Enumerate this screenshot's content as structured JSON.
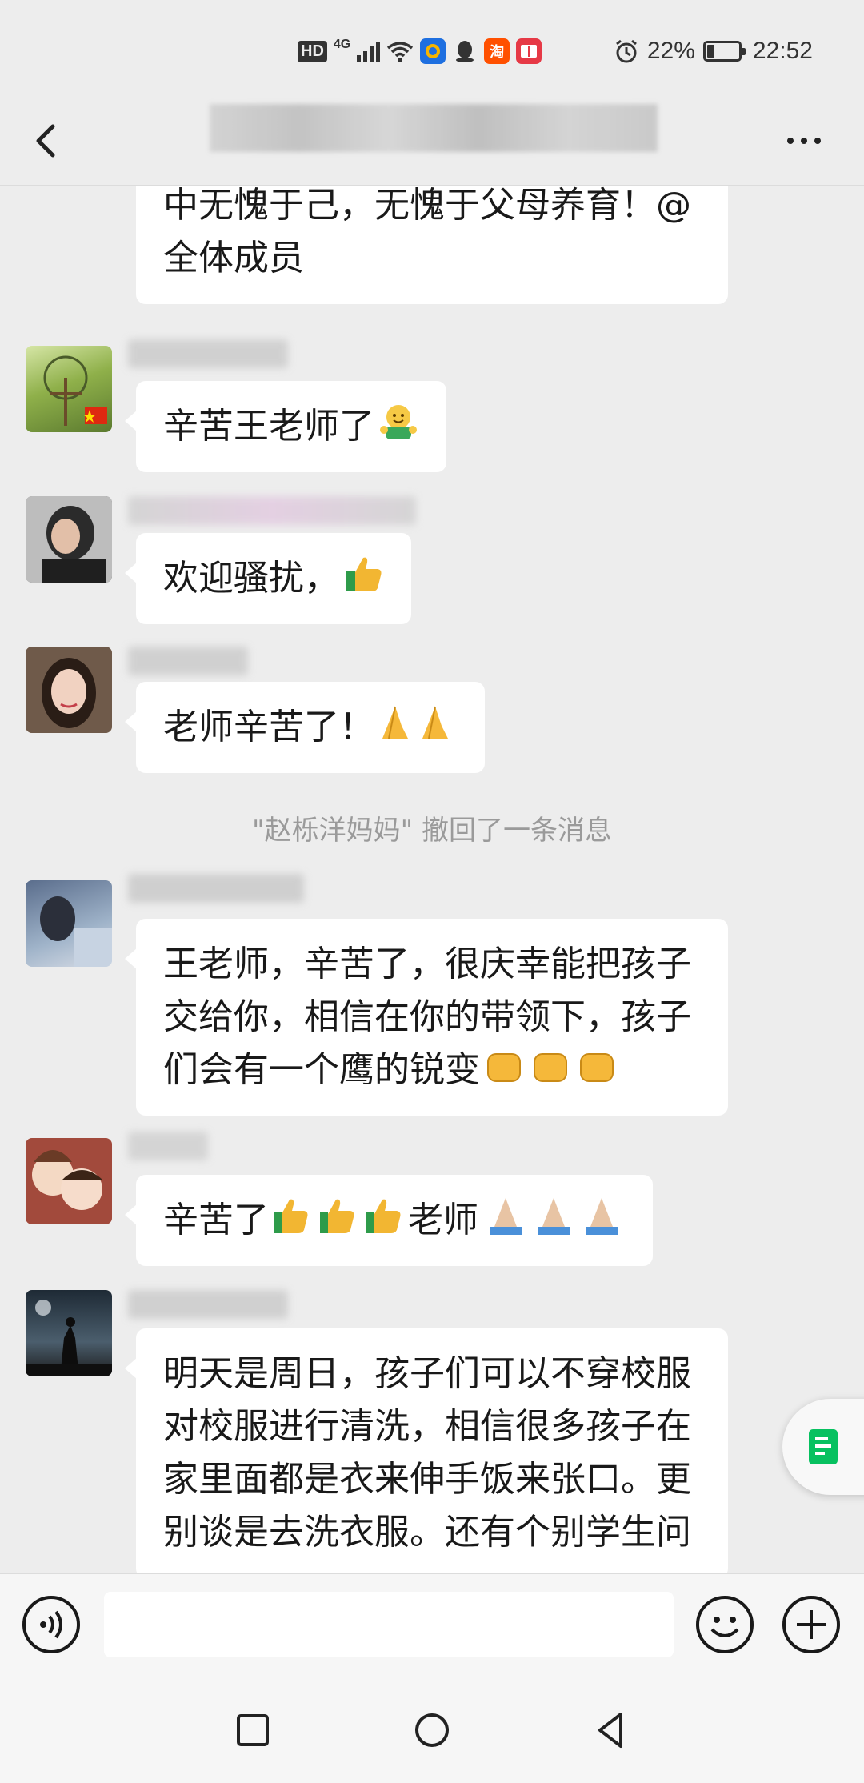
{
  "status_bar": {
    "network_hd": "HD",
    "network_type": "4G",
    "battery_percent": "22%",
    "time": "22:52",
    "app_icons": [
      "qq-browser-icon",
      "qq-icon",
      "taobao-icon",
      "reader-icon"
    ],
    "taobao_glyph": "淘"
  },
  "title_bar": {
    "title": "",
    "back_icon": "chevron-left-icon",
    "more_icon": "more-icon"
  },
  "messages": [
    {
      "text_lines": [
        "中无愧于己，无愧于父母养育！@",
        "全体成员"
      ]
    },
    {
      "text": "辛苦王老师了"
    },
    {
      "text": "欢迎骚扰，"
    },
    {
      "text": "老师辛苦了！"
    },
    {
      "text_lines": [
        "王老师，辛苦了，很庆幸能把孩子",
        "交给你，相信在你的带领下，孩子",
        "们会有一个鹰的锐变"
      ]
    },
    {
      "text_a": "辛苦了",
      "text_b": "老师"
    },
    {
      "text_lines": [
        "明天是周日，孩子们可以不穿校服",
        "对校服进行清洗，相信很多孩子在",
        "家里面都是衣来伸手饭来张口。更",
        "别谈是去洗衣服。还有个别学生问"
      ]
    }
  ],
  "system_message": "\"赵栎洋妈妈\" 撤回了一条消息",
  "input_bar": {
    "placeholder": "",
    "voice_icon": "voice-icon",
    "emoji_icon": "emoji-icon",
    "plus_icon": "plus-icon"
  },
  "colors": {
    "background": "#ededed",
    "bubble": "#ffffff",
    "accent_green": "#07c160",
    "system_text": "#9a9a9a"
  }
}
